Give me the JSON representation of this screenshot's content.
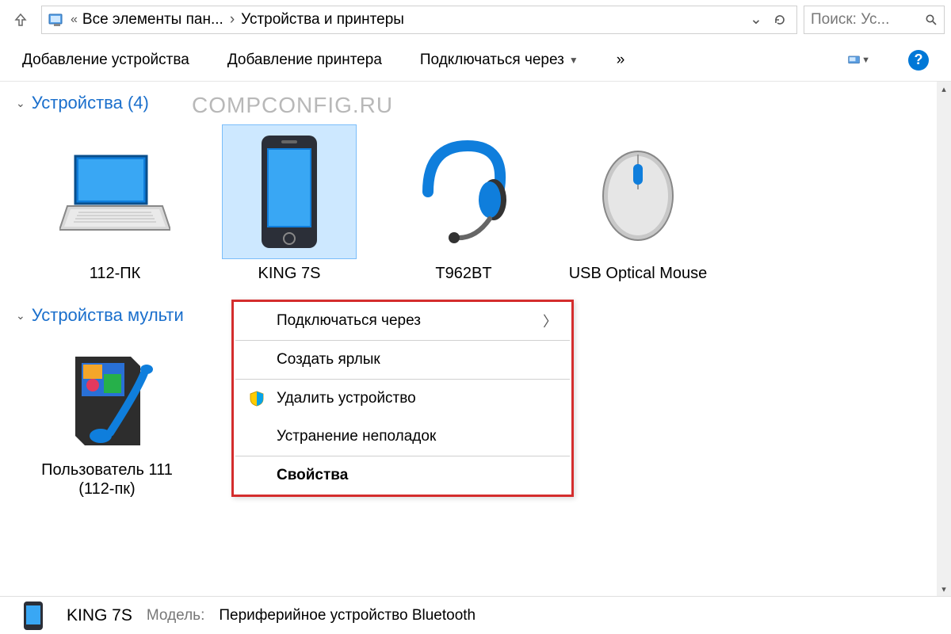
{
  "address_bar": {
    "crumb1": "Все элементы пан...",
    "crumb2": "Устройства и принтеры"
  },
  "search": {
    "placeholder": "Поиск: Ус..."
  },
  "toolbar": {
    "add_device": "Добавление устройства",
    "add_printer": "Добавление принтера",
    "connect_via": "Подключаться через",
    "overflow": "»"
  },
  "watermark": "COMPCONFIG.RU",
  "groups": {
    "devices_header": "Устройства (4)",
    "multimedia_header": "Устройства мульти"
  },
  "devices": [
    {
      "label": "112-ПК"
    },
    {
      "label": "KING 7S"
    },
    {
      "label": "T962BT"
    },
    {
      "label": "USB Optical Mouse"
    }
  ],
  "multimedia": [
    {
      "label": "Пользователь 111 (112-пк)"
    }
  ],
  "context_menu": {
    "connect_via": "Подключаться через",
    "create_shortcut": "Создать ярлык",
    "remove_device": "Удалить устройство",
    "troubleshoot": "Устранение неполадок",
    "properties": "Свойства"
  },
  "details": {
    "title": "KING 7S",
    "model_label": "Модель:",
    "model_value": "Периферийное устройство Bluetooth"
  }
}
